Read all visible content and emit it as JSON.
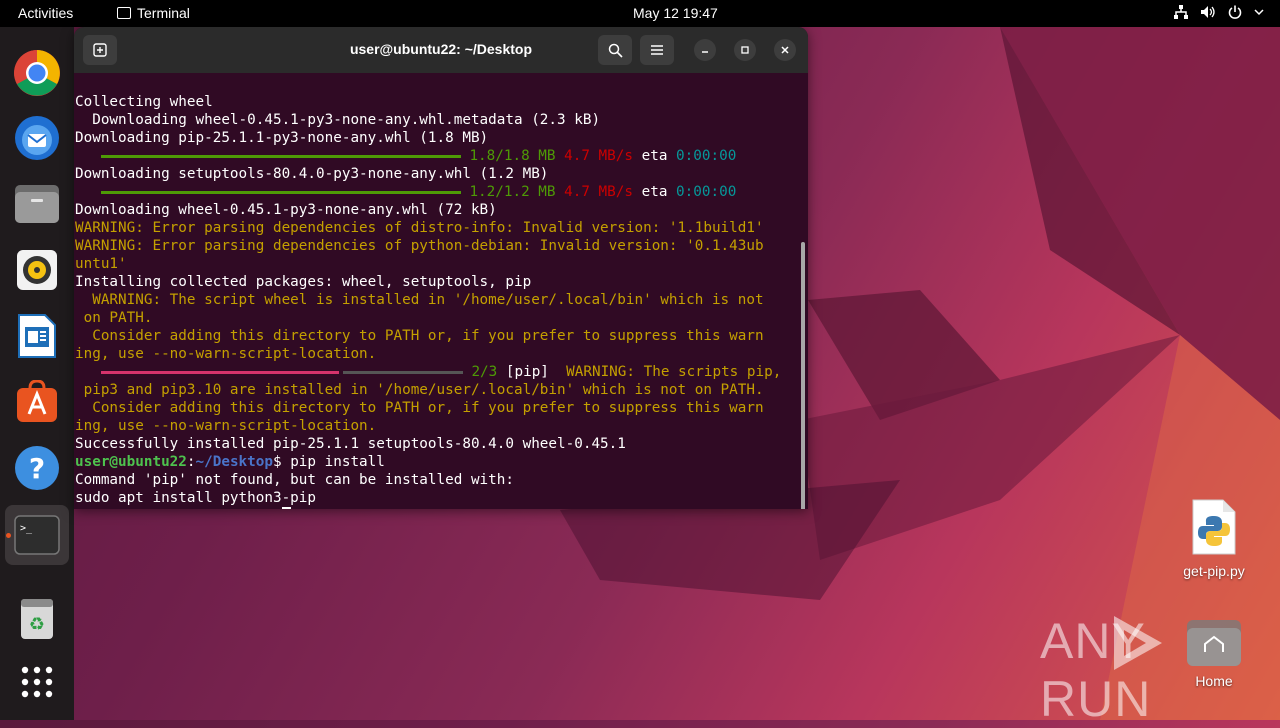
{
  "topbar": {
    "activities": "Activities",
    "app_name": "Terminal",
    "clock": "May 12  19:47"
  },
  "dock": {
    "items": [
      "chrome",
      "thunderbird",
      "files",
      "rhythmbox",
      "libreoffice-writer",
      "app-center",
      "help",
      "terminal",
      "trash",
      "show-apps"
    ]
  },
  "terminal": {
    "title": "user@ubuntu22: ~/Desktop",
    "lines": {
      "l1": "Collecting wheel",
      "l2": "  Downloading wheel-0.45.1-py3-none-any.whl.metadata (2.3 kB)",
      "l3": "Downloading pip-25.1.1-py3-none-any.whl (1.8 MB)",
      "l4_progress": "1.8/1.8 MB",
      "l4_speed": "4.7 MB/s",
      "l4_eta_label": "eta",
      "l4_eta": "0:00:00",
      "l5": "Downloading setuptools-80.4.0-py3-none-any.whl (1.2 MB)",
      "l6_progress": "1.2/1.2 MB",
      "l6_speed": "4.7 MB/s",
      "l6_eta_label": "eta",
      "l6_eta": "0:00:00",
      "l7": "Downloading wheel-0.45.1-py3-none-any.whl (72 kB)",
      "l8": "WARNING: Error parsing dependencies of distro-info: Invalid version: '1.1build1'",
      "l9": "WARNING: Error parsing dependencies of python-debian: Invalid version: '0.1.43ub",
      "l10": "untu1'",
      "l11": "Installing collected packages: wheel, setuptools, pip",
      "l12": "  WARNING: The script wheel is installed in '/home/user/.local/bin' which is not",
      "l13": " on PATH.",
      "l14": "  Consider adding this directory to PATH or, if you prefer to suppress this warn",
      "l15": "ing, use --no-warn-script-location.",
      "l16_progress": "2/3",
      "l16_pkg": "[pip]",
      "l16_warn": "  WARNING: The scripts pip,",
      "l17": " pip3 and pip3.10 are installed in '/home/user/.local/bin' which is not on PATH.",
      "l18": "  Consider adding this directory to PATH or, if you prefer to suppress this warn",
      "l19": "ing, use --no-warn-script-location.",
      "l20": "Successfully installed pip-25.1.1 setuptools-80.4.0 wheel-0.45.1",
      "prompt_user": "user@ubuntu22",
      "prompt_colon": ":",
      "prompt_path": "~/Desktop",
      "prompt_dollar": "$",
      "cmd1": " pip install",
      "l22": "Command 'pip' not found, but can be installed with:",
      "l23": "sudo apt install python3-pip"
    }
  },
  "desktop": {
    "file_label": "get-pip.py",
    "home_label": "Home",
    "watermark": "ANY RUN"
  },
  "colors": {
    "terminal_bg": "#300a24",
    "accent": "#e95420"
  }
}
